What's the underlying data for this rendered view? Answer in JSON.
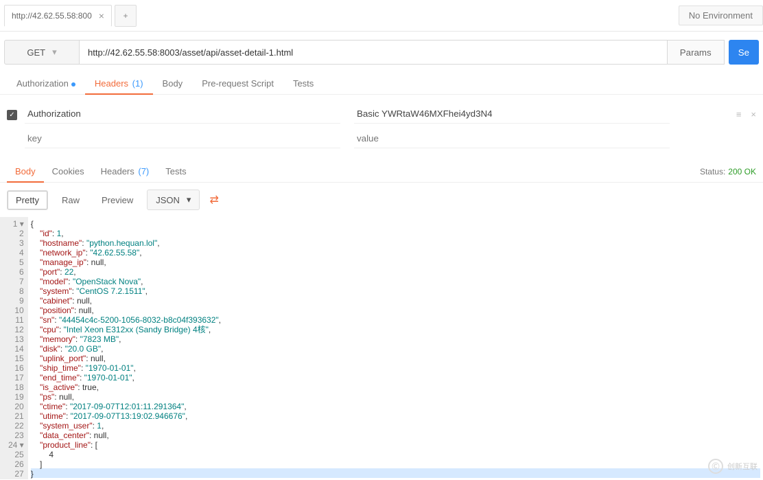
{
  "tabs": {
    "active": "http://42.62.55.58:800"
  },
  "environment": "No Environment",
  "request": {
    "method": "GET",
    "url": "http://42.62.55.58:8003/asset/api/asset-detail-1.html",
    "params_label": "Params",
    "send_label": "Se"
  },
  "req_tabs": {
    "authorization": "Authorization",
    "headers": "Headers",
    "headers_count": "(1)",
    "body": "Body",
    "prerequest": "Pre-request Script",
    "tests": "Tests"
  },
  "headers": {
    "row1_key": "Authorization",
    "row1_val": "Basic YWRtaW46MXFhei4yd3N4",
    "row2_key_ph": "key",
    "row2_val_ph": "value"
  },
  "resp_tabs": {
    "body": "Body",
    "cookies": "Cookies",
    "headers": "Headers",
    "headers_count": "(7)",
    "tests": "Tests"
  },
  "status_label": "Status:",
  "status_value": "200 OK",
  "view": {
    "pretty": "Pretty",
    "raw": "Raw",
    "preview": "Preview",
    "format": "JSON"
  },
  "json_lines": [
    "{",
    "    \"id\": 1,",
    "    \"hostname\": \"python.hequan.lol\",",
    "    \"network_ip\": \"42.62.55.58\",",
    "    \"manage_ip\": null,",
    "    \"port\": 22,",
    "    \"model\": \"OpenStack Nova\",",
    "    \"system\": \"CentOS 7.2.1511\",",
    "    \"cabinet\": null,",
    "    \"position\": null,",
    "    \"sn\": \"44454c4c-5200-1056-8032-b8c04f393632\",",
    "    \"cpu\": \"Intel Xeon E312xx (Sandy Bridge) 4核\",",
    "    \"memory\": \"7823 MB\",",
    "    \"disk\": \"20.0 GB\",",
    "    \"uplink_port\": null,",
    "    \"ship_time\": \"1970-01-01\",",
    "    \"end_time\": \"1970-01-01\",",
    "    \"is_active\": true,",
    "    \"ps\": null,",
    "    \"ctime\": \"2017-09-07T12:01:11.291364\",",
    "    \"utime\": \"2017-09-07T13:19:02.946676\",",
    "    \"system_user\": 1,",
    "    \"data_center\": null,",
    "    \"product_line\": [",
    "        4",
    "    ]",
    "}"
  ],
  "watermark": "创新互联"
}
